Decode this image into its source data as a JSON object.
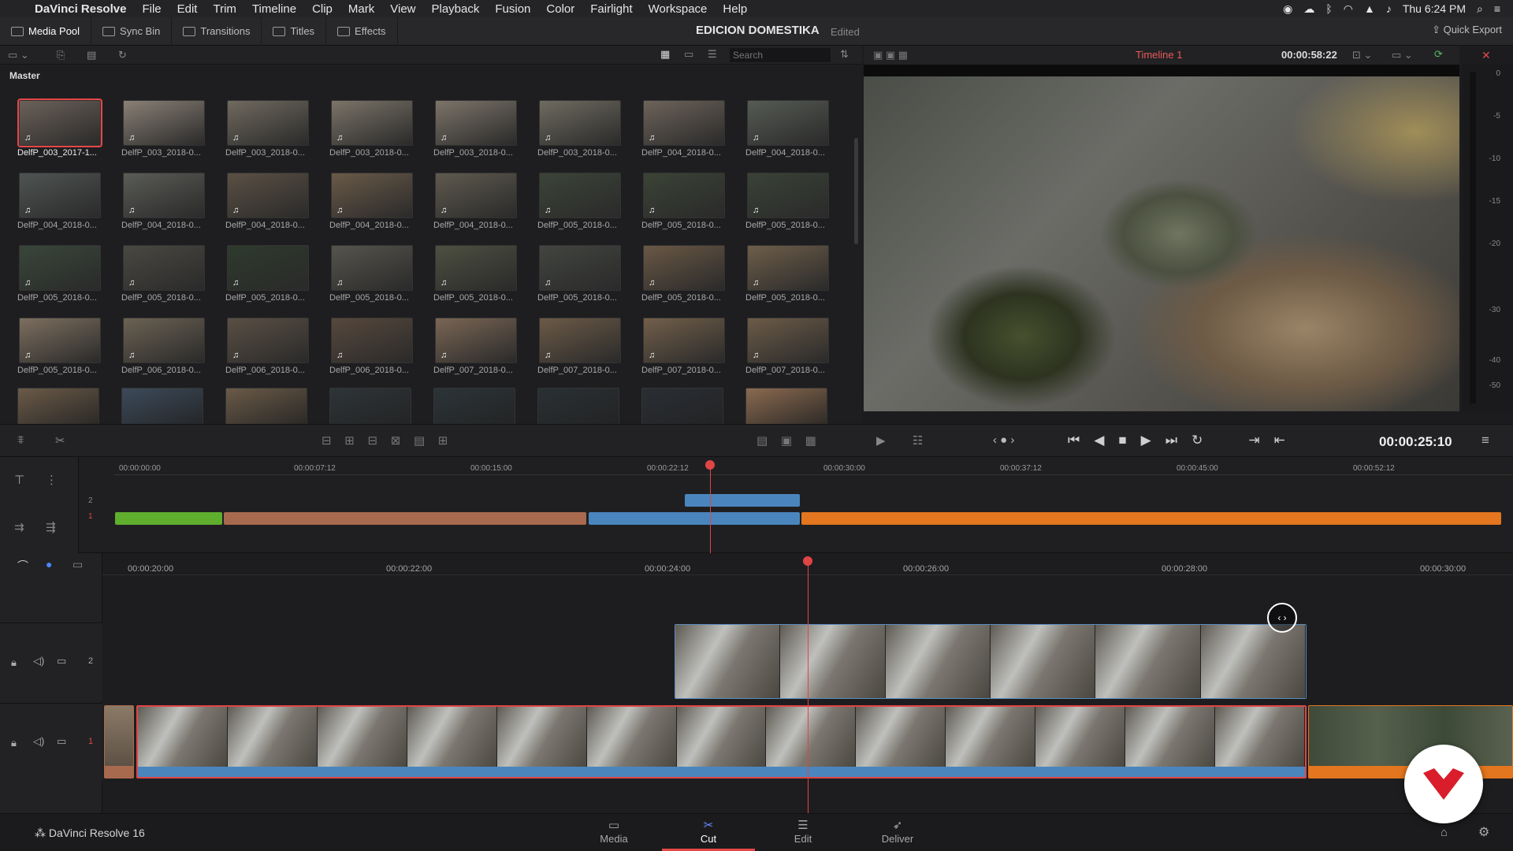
{
  "menubar": {
    "app_name": "DaVinci Resolve",
    "items": [
      "File",
      "Edit",
      "Trim",
      "Timeline",
      "Clip",
      "Mark",
      "View",
      "Playback",
      "Fusion",
      "Color",
      "Fairlight",
      "Workspace",
      "Help"
    ],
    "clock": "Thu 6:24 PM"
  },
  "toolbar": {
    "media_pool": "Media Pool",
    "sync_bin": "Sync Bin",
    "transitions": "Transitions",
    "titles": "Titles",
    "effects": "Effects",
    "project_title": "EDICION DOMESTIKA",
    "edited": "Edited",
    "quick_export": "Quick Export"
  },
  "media_pool": {
    "search_placeholder": "Search",
    "bin": "Master",
    "clips": [
      "DelfP_003_2017-1...",
      "DelfP_003_2018-0...",
      "DelfP_003_2018-0...",
      "DelfP_003_2018-0...",
      "DelfP_003_2018-0...",
      "DelfP_003_2018-0...",
      "DelfP_004_2018-0...",
      "DelfP_004_2018-0...",
      "DelfP_004_2018-0...",
      "DelfP_004_2018-0...",
      "DelfP_004_2018-0...",
      "DelfP_004_2018-0...",
      "DelfP_004_2018-0...",
      "DelfP_005_2018-0...",
      "DelfP_005_2018-0...",
      "DelfP_005_2018-0...",
      "DelfP_005_2018-0...",
      "DelfP_005_2018-0...",
      "DelfP_005_2018-0...",
      "DelfP_005_2018-0...",
      "DelfP_005_2018-0...",
      "DelfP_005_2018-0...",
      "DelfP_005_2018-0...",
      "DelfP_005_2018-0...",
      "DelfP_005_2018-0...",
      "DelfP_006_2018-0...",
      "DelfP_006_2018-0...",
      "DelfP_006_2018-0...",
      "DelfP_007_2018-0...",
      "DelfP_007_2018-0...",
      "DelfP_007_2018-0...",
      "DelfP_007_2018-0..."
    ],
    "thumb_colors": [
      "#6b6159",
      "#8a8076",
      "#706a5f",
      "#7b7468",
      "#7c7469",
      "#6f6b60",
      "#6d635a",
      "#565b54",
      "#4f5452",
      "#5a5c56",
      "#5b5044",
      "#6a5a48",
      "#5f5a4f",
      "#3c4438",
      "#3b4336",
      "#3a4237",
      "#39463a",
      "#4a4842",
      "#2e3a2c",
      "#56544d",
      "#4d5041",
      "#424540",
      "#6a5845",
      "#6e5e4a",
      "#7d6f5f",
      "#6b6253",
      "#5a4f44",
      "#57483c",
      "#7a6654",
      "#6c5a47",
      "#725f4a",
      "#6c5b48"
    ]
  },
  "viewer": {
    "timeline_name": "Timeline 1",
    "duration": "00:00:58:22",
    "current_timecode": "00:00:25:10",
    "meter_ticks": [
      "0",
      "-5",
      "-10",
      "-15",
      "-20",
      "-30",
      "-40",
      "-50"
    ]
  },
  "timeline": {
    "upper_ruler": [
      "00:00:00:00",
      "00:00:07:12",
      "00:00:15:00",
      "00:00:22:12",
      "00:00:30:00",
      "00:00:37:12",
      "00:00:45:00",
      "00:00:52:12"
    ],
    "lower_ruler": [
      "00:00:20:00",
      "00:00:22:00",
      "00:00:24:00",
      "00:00:26:00",
      "00:00:28:00",
      "00:00:30:00"
    ],
    "track_labels": [
      "2",
      "1"
    ],
    "colors": {
      "green": "#5fae2e",
      "brown": "#a86a4e",
      "blue": "#4a86bd",
      "orange": "#e3761f"
    }
  },
  "pages": {
    "media": "Media",
    "cut": "Cut",
    "edit": "Edit",
    "deliver": "Deliver",
    "brand": "DaVinci Resolve 16"
  }
}
